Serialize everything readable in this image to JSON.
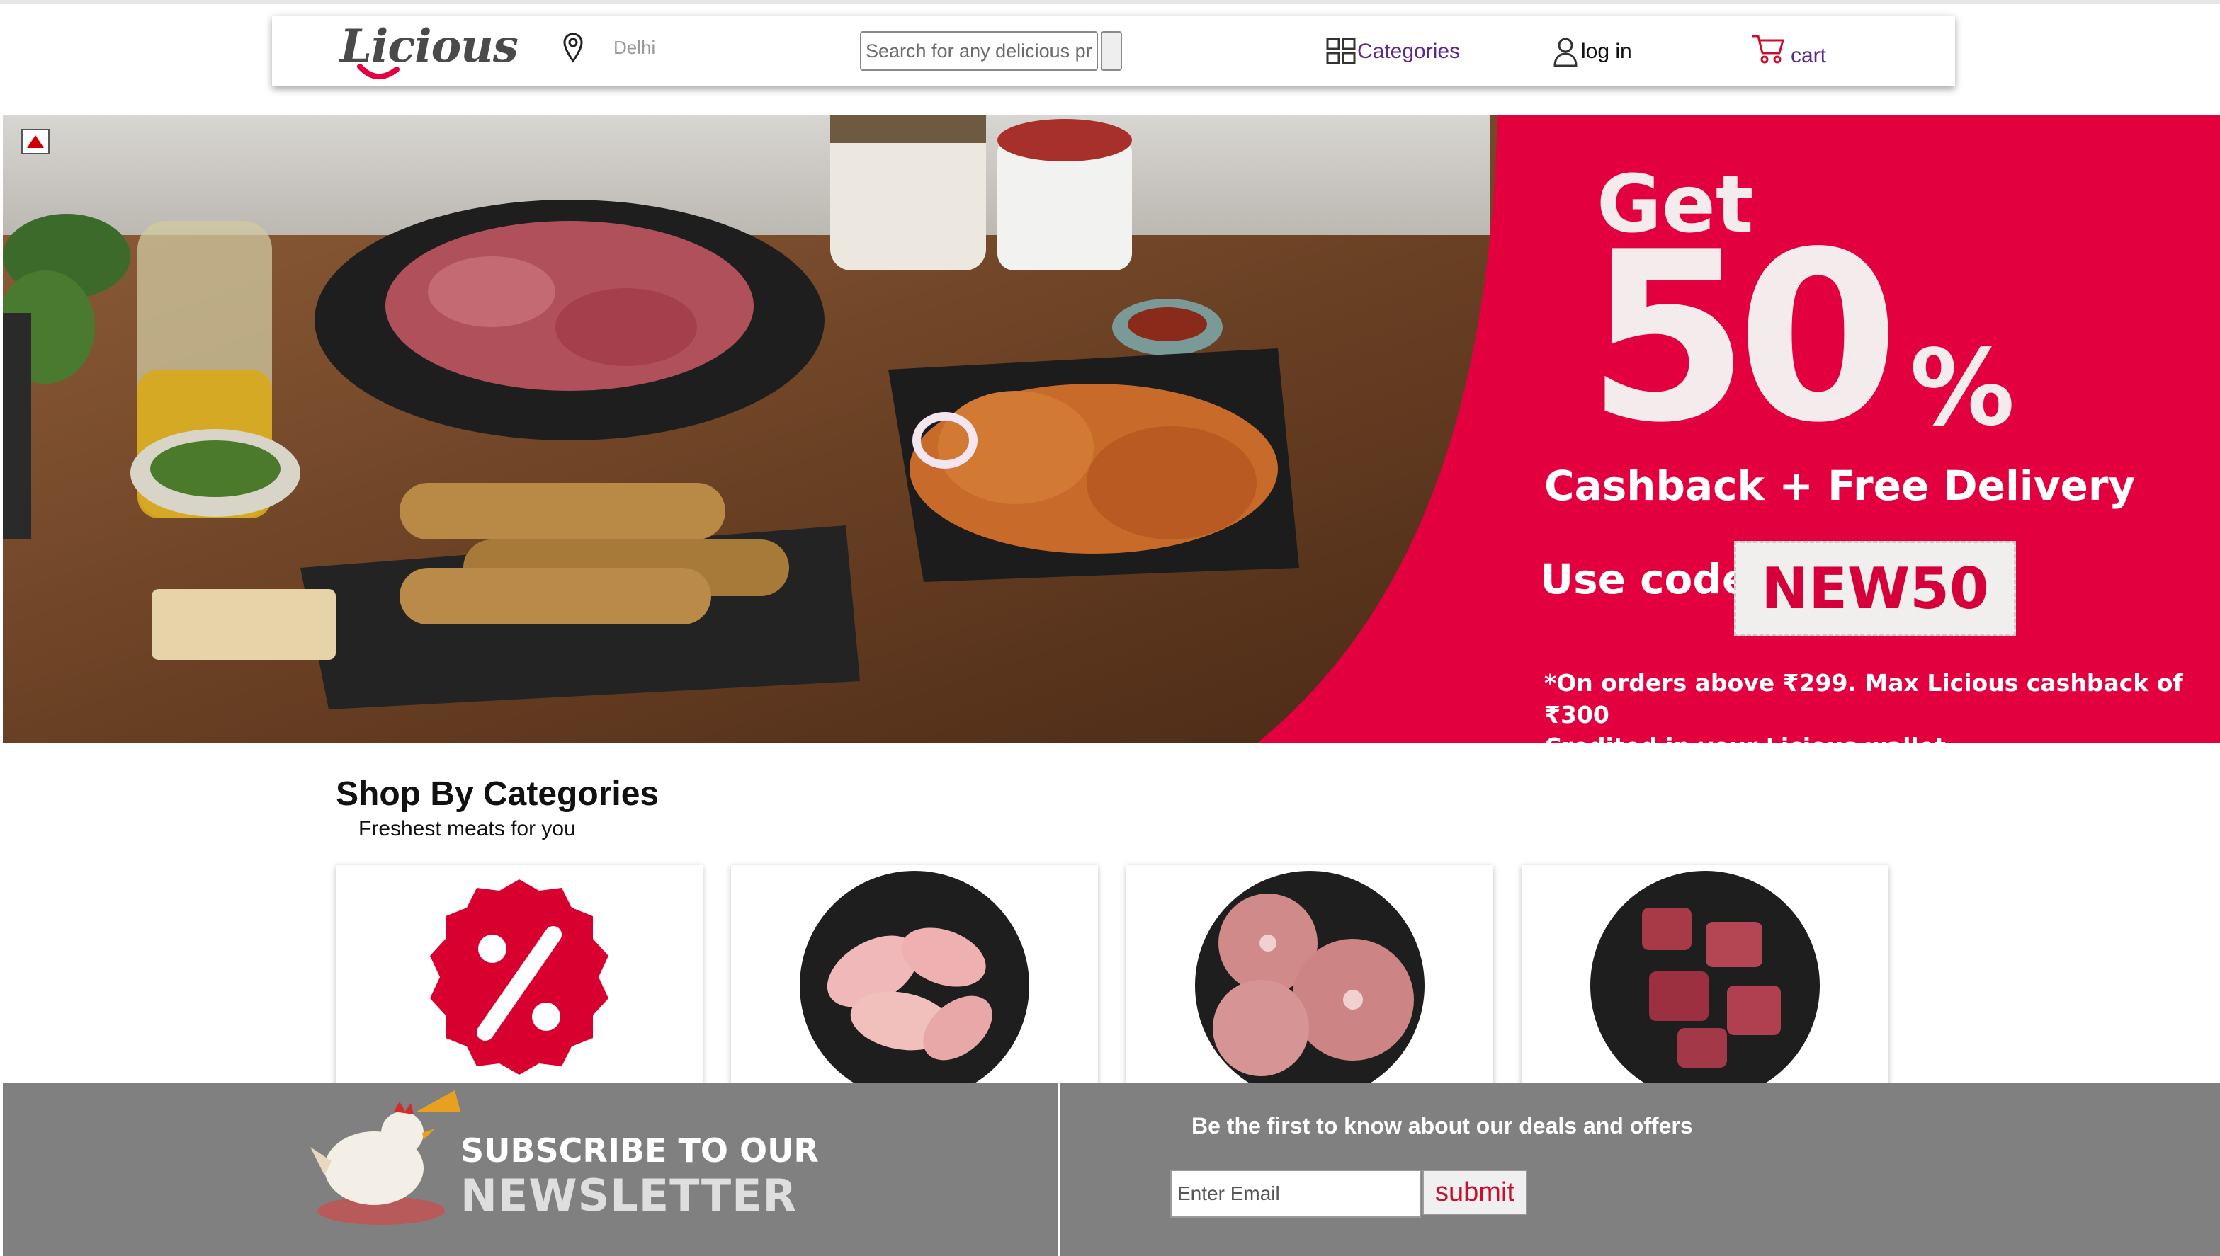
{
  "header": {
    "logo_text": "Licious",
    "location": "Delhi",
    "search_placeholder": "Search for any delicious product",
    "categories_label": "Categories",
    "login_label": "log in",
    "cart_label": "cart"
  },
  "banner": {
    "get": "Get",
    "percent_number": "50",
    "percent_sign": "%",
    "cashback_line": "Cashback + Free Delivery",
    "use_code_label": "Use code",
    "code": "NEW50",
    "note_line1": "*On orders above ₹299. Max Licious cashback of ₹300",
    "note_line2": "Credited in your Licious wallet"
  },
  "categories": {
    "title": "Shop By Categories",
    "subtitle": "Freshest meats for you",
    "cards": [
      {
        "icon": "percent-offer-icon"
      },
      {
        "icon": "chicken-icon"
      },
      {
        "icon": "fish-steak-icon"
      },
      {
        "icon": "mutton-icon"
      }
    ]
  },
  "newsletter": {
    "line1": "SUBSCRIBE TO OUR",
    "line2": "NEWSLETTER",
    "tagline": "Be the first to know about our deals and offers",
    "email_placeholder": "Enter Email",
    "submit_label": "submit"
  },
  "colors": {
    "brand_red": "#e3003e",
    "brand_purple": "#5a2a8a",
    "footer_gray": "#808080"
  }
}
